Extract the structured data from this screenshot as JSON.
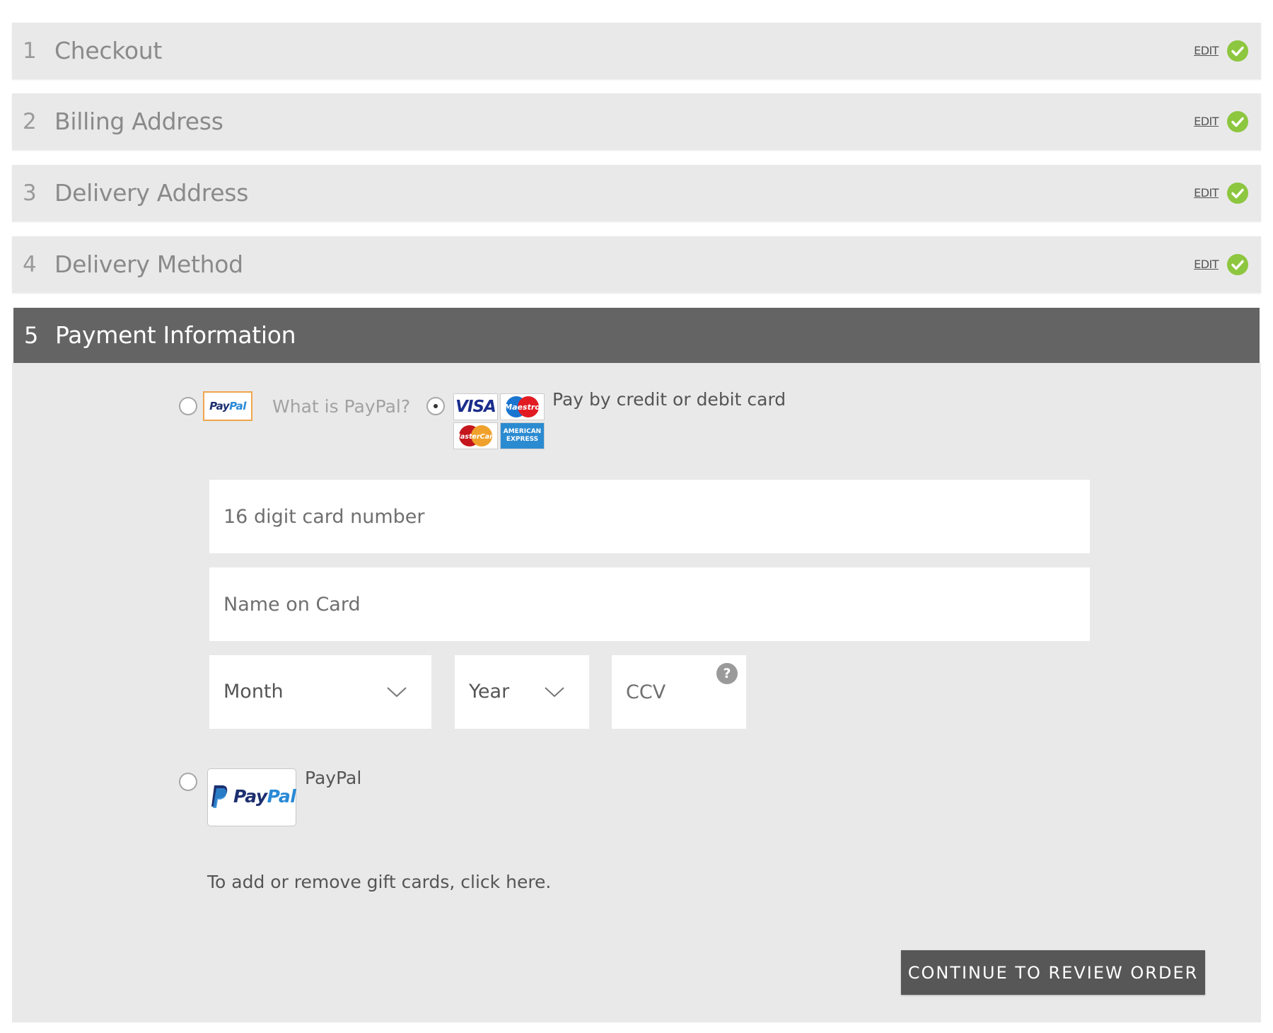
{
  "steps": [
    {
      "number": "1",
      "title": "Checkout",
      "edit_label": "EDIT",
      "status_icon": "check-circle-icon"
    },
    {
      "number": "2",
      "title": "Billing Address",
      "edit_label": "EDIT",
      "status_icon": "check-circle-icon"
    },
    {
      "number": "3",
      "title": "Delivery Address",
      "edit_label": "EDIT",
      "status_icon": "check-circle-icon"
    },
    {
      "number": "4",
      "title": "Delivery Method",
      "edit_label": "EDIT",
      "status_icon": "check-circle-icon"
    }
  ],
  "active_step": {
    "number": "5",
    "title": "Payment Information"
  },
  "payment": {
    "paypal_badge": {
      "pay": "Pay",
      "pal": "Pal"
    },
    "what_is_paypal": "What is PayPal?",
    "card_option_label": "Pay by credit or debit card",
    "card_option_selected": true,
    "card_logos": {
      "visa": "VISA",
      "maestro": "Maestro",
      "mastercard": "MasterCard",
      "amex_line1": "AMERICAN",
      "amex_line2": "EXPRESS"
    },
    "card_number_placeholder": "16 digit card number",
    "name_placeholder": "Name on Card",
    "month_value": "Month",
    "year_value": "Year",
    "ccv_placeholder": "CCV",
    "ccv_help": "?",
    "paypal_option_label": "PayPal",
    "paypal_logo": {
      "pay": "Pay",
      "pal": "Pal"
    },
    "gift_cards_text": "To add or remove gift cards, click here.",
    "continue_label": "CONTINUE TO REVIEW ORDER"
  },
  "colors": {
    "step_bg": "#e9e9e9",
    "active_header_bg": "#646464",
    "check_green": "#8dc63f",
    "button_bg": "#575757",
    "paypal_border": "#f0a64b"
  }
}
